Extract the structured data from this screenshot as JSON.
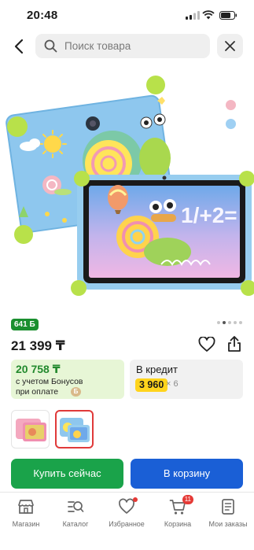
{
  "status_bar": {
    "time": "20:48"
  },
  "search": {
    "placeholder": "Поиск товара"
  },
  "gallery": {
    "color_options": [
      "#f4b7c3",
      "#9fd0f3"
    ]
  },
  "product": {
    "bonus_badge": "641 Б",
    "price": "21 399 ₸"
  },
  "bonus_card": {
    "amount": "20 758 ₸",
    "line1": "с учетом Бонусов",
    "line2": "при оплате",
    "bonus_glyph": "Б"
  },
  "credit_card": {
    "title": "В кредит",
    "monthly": "3 960",
    "months": "× 6"
  },
  "actions": {
    "buy_now": "Купить сейчас",
    "add_to_cart": "В корзину"
  },
  "tabbar": {
    "items": [
      {
        "label": "Магазин",
        "icon": "store-icon"
      },
      {
        "label": "Каталог",
        "icon": "catalog-icon"
      },
      {
        "label": "Избранное",
        "icon": "heart-icon"
      },
      {
        "label": "Корзина",
        "icon": "cart-icon",
        "badge": "11"
      },
      {
        "label": "Мои заказы",
        "icon": "orders-icon"
      }
    ]
  }
}
